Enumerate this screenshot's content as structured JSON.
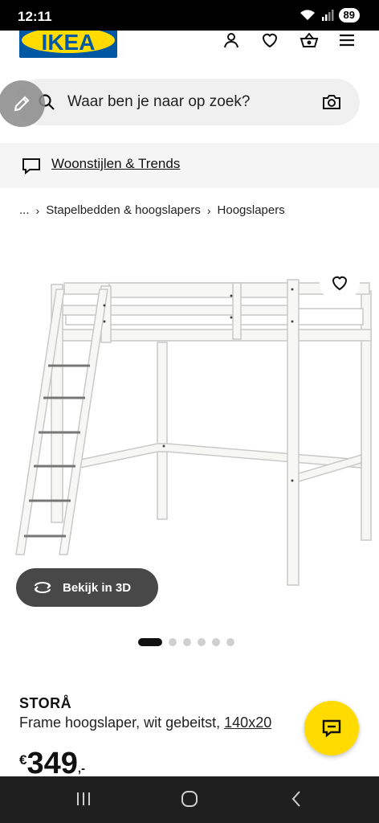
{
  "status": {
    "time": "12:11",
    "battery": "89"
  },
  "header": {
    "logo_text": "IKEA"
  },
  "search": {
    "placeholder": "Waar ben je naar op zoek?"
  },
  "trends": {
    "label": "Woonstijlen & Trends"
  },
  "breadcrumb": {
    "items": [
      "...",
      "Stapelbedden & hoogslapers",
      "Hoogslapers"
    ]
  },
  "view3d": {
    "label": "Bekijk in 3D"
  },
  "carousel": {
    "count": 6,
    "active_index": 0
  },
  "product": {
    "name": "STORÅ",
    "description": "Frame hoogslaper, wit gebeitst,",
    "size": "140x20",
    "price_currency": "€",
    "price_whole": "349",
    "price_decimal": ",-"
  },
  "colors": {
    "ikea_blue": "#0058a3",
    "ikea_yellow": "#ffdb00"
  }
}
